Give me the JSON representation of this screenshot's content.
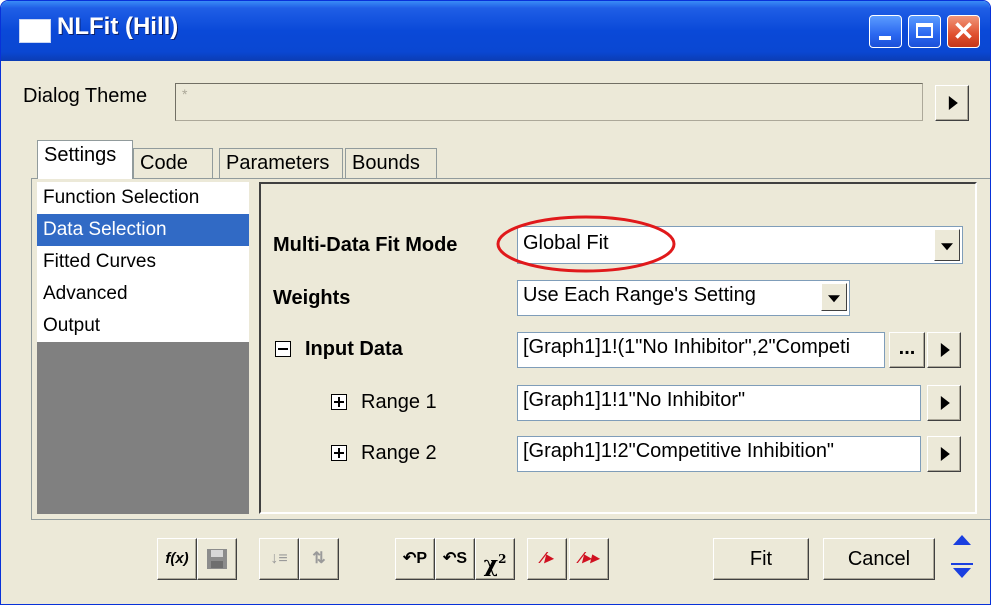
{
  "window": {
    "title": "NLFit (Hill)"
  },
  "theme": {
    "label": "Dialog Theme",
    "value": "*"
  },
  "tabs": [
    {
      "label": "Settings",
      "active": true
    },
    {
      "label": "Code"
    },
    {
      "label": "Parameters"
    },
    {
      "label": "Bounds"
    }
  ],
  "nav": [
    {
      "label": "Function Selection"
    },
    {
      "label": "Data Selection",
      "selected": true
    },
    {
      "label": "Fitted Curves"
    },
    {
      "label": "Advanced"
    },
    {
      "label": "Output"
    }
  ],
  "settings": {
    "multi_fit_label": "Multi-Data Fit Mode",
    "multi_fit_value": "Global Fit",
    "weights_label": "Weights",
    "weights_value": "Use Each Range's Setting",
    "input_label": "Input Data",
    "input_value": "[Graph1]1!(1\"No Inhibitor\",2\"Competi",
    "range1_label": "Range 1",
    "range1_value": "[Graph1]1!1\"No Inhibitor\"",
    "range2_label": "Range 2",
    "range2_value": "[Graph1]1!2\"Competitive Inhibition\"",
    "ellipsis": "..."
  },
  "toolbar": {
    "tools": [
      "f(x)-icon",
      "save-icon",
      "sort-icon",
      "tree-icon",
      "reset-p-icon",
      "reset-s-icon",
      "chi-square-icon",
      "fit-one-icon",
      "fit-until-converge-icon"
    ],
    "fit_label": "Fit",
    "cancel_label": "Cancel",
    "chi_main": "χ",
    "chi_sup": "2"
  },
  "colors": {
    "title_bar": "#0a49d8",
    "highlight": "#316ac5",
    "annotation_circle": "#e0191b"
  }
}
